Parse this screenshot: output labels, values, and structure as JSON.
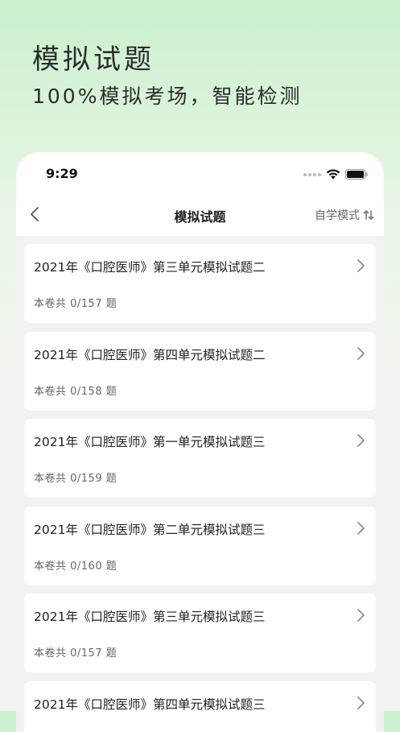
{
  "promo": {
    "title": "模拟试题",
    "subtitle": "100%模拟考场，智能检测"
  },
  "status_bar": {
    "time": "9:29"
  },
  "navbar": {
    "title": "模拟试题",
    "mode_label": "自学模式"
  },
  "icons": {
    "back": "chevron-left-icon",
    "sort": "sort-arrows-icon",
    "row_arrow": "chevron-right-icon",
    "wifi": "wifi-icon",
    "battery": "battery-icon",
    "signal": "signal-icon"
  },
  "colors": {
    "accent_green": "#c9f0cd",
    "card_bg": "#ffffff",
    "page_bg": "#f2f2f2"
  },
  "papers": [
    {
      "title": "2021年《口腔医师》第三单元模拟试题二",
      "count": "本卷共 0/157 题"
    },
    {
      "title": "2021年《口腔医师》第四单元模拟试题二",
      "count": "本卷共 0/158 题"
    },
    {
      "title": "2021年《口腔医师》第一单元模拟试题三",
      "count": "本卷共 0/159 题"
    },
    {
      "title": "2021年《口腔医师》第二单元模拟试题三",
      "count": "本卷共 0/160 题"
    },
    {
      "title": "2021年《口腔医师》第三单元模拟试题三",
      "count": "本卷共 0/157 题"
    },
    {
      "title": "2021年《口腔医师》第四单元模拟试题三",
      "count": ""
    }
  ]
}
